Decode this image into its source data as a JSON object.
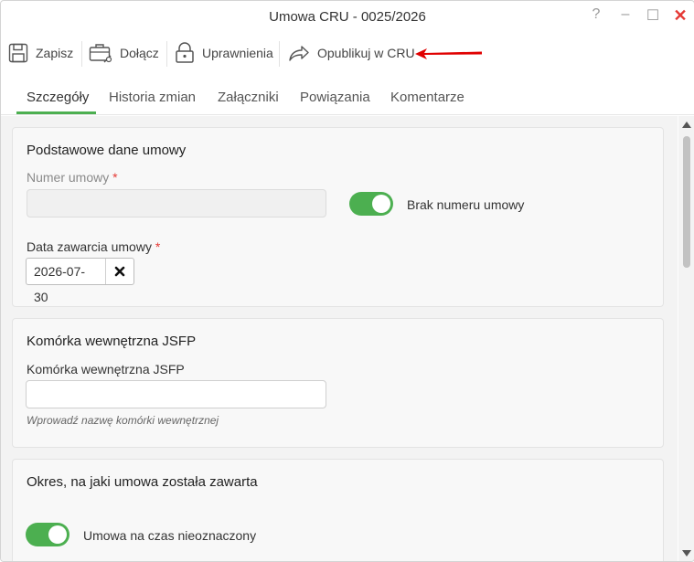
{
  "window": {
    "title": "Umowa CRU - 0025/2026",
    "help": "?",
    "minimize": "–",
    "maximize": "☐",
    "close": "✕"
  },
  "toolbar": {
    "save_label": "Zapisz",
    "attach_label": "Dołącz",
    "permissions_label": "Uprawnienia",
    "publish_label": "Opublikuj w CRU"
  },
  "tabs": [
    {
      "label": "Szczegóły"
    },
    {
      "label": "Historia zmian"
    },
    {
      "label": "Załączniki"
    },
    {
      "label": "Powiązania"
    },
    {
      "label": "Komentarze"
    }
  ],
  "sections": {
    "basic": {
      "title": "Podstawowe dane umowy",
      "number_label": "Numer umowy",
      "number_value": "",
      "no_number_label": "Brak numeru umowy",
      "date_label": "Data zawarcia umowy",
      "date_value": "2026-07-30"
    },
    "unit": {
      "title": "Komórka wewnętrzna JSFP",
      "field_label": "Komórka wewnętrzna JSFP",
      "field_value": "",
      "hint": "Wprowadź nazwę komórki wewnętrznej"
    },
    "period": {
      "title": "Okres, na jaki umowa została zawarta",
      "indefinite_label": "Umowa na czas nieoznaczony"
    }
  },
  "required_mark": "*",
  "colors": {
    "accent": "#4caf50",
    "close": "#e53935",
    "annotation_arrow": "#e00000"
  }
}
